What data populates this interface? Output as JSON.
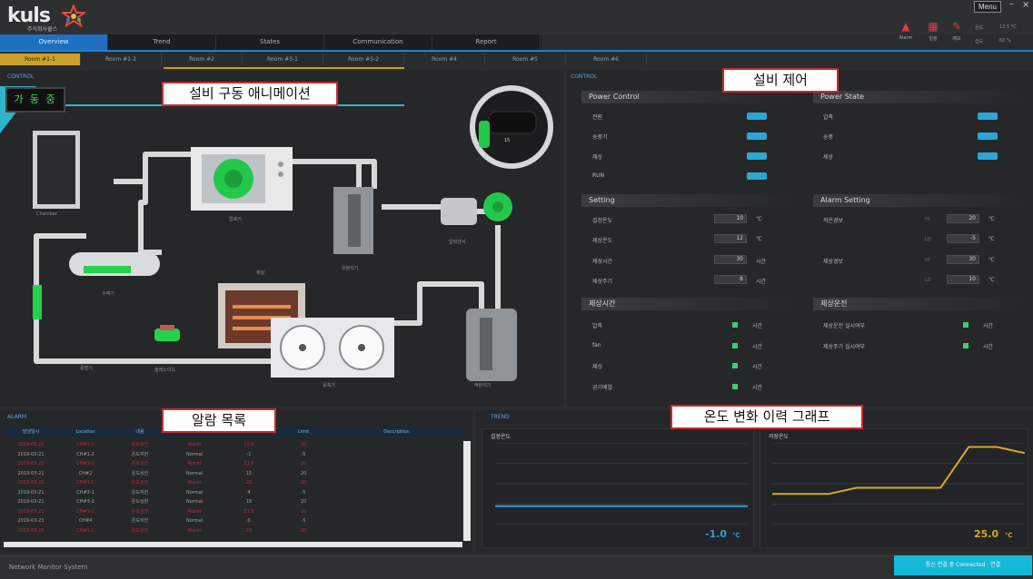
{
  "app": {
    "logo_text": "kuls",
    "logo_subtitle": "주식회사쿨스",
    "menu_label": "Menu",
    "minimize_glyph": "–",
    "close_glyph": "×"
  },
  "nav": {
    "tabs": [
      {
        "label": "Overview",
        "active": true
      },
      {
        "label": "Trend",
        "active": false
      },
      {
        "label": "States",
        "active": false
      },
      {
        "label": "Communication",
        "active": false
      },
      {
        "label": "Report",
        "active": false
      }
    ]
  },
  "subnav": {
    "tabs": [
      {
        "label": "Room #1-1",
        "active": true
      },
      {
        "label": "Room #1-2",
        "active": false
      },
      {
        "label": "Room #2",
        "active": false
      },
      {
        "label": "Room #3-1",
        "active": false
      },
      {
        "label": "Room #3-2",
        "active": false
      },
      {
        "label": "Room #4",
        "active": false
      },
      {
        "label": "Room #5",
        "active": false
      },
      {
        "label": "Room #6",
        "active": false
      }
    ]
  },
  "top_icons": [
    {
      "icon": "alarm-bell-icon",
      "label": "Alarm"
    },
    {
      "icon": "calendar-icon",
      "label": "일정"
    },
    {
      "icon": "edit-icon",
      "label": "메모"
    }
  ],
  "top_status": [
    "온도",
    "12.5 °C",
    "습도",
    "60 %"
  ],
  "animation_panel": {
    "title": "CONTROL",
    "display_value": "가 동 중",
    "equipment_labels": {
      "door": "Chamber",
      "compressor": "압축기",
      "receiver": "수액기",
      "filter": "유분리기",
      "pump": "압력센서",
      "valve": "솔레노이드",
      "heater": "제상",
      "condenser": "응축기",
      "accumulator": "액분리기",
      "evaporator_label": "증발기"
    },
    "gauge_value": "15"
  },
  "control_panel": {
    "title": "CONTROL",
    "power_control": {
      "heading": "Power Control",
      "rows": [
        "전원",
        "송풍기",
        "제상",
        "RUN"
      ]
    },
    "power_state": {
      "heading": "Power State",
      "rows": [
        "압축",
        "송풍",
        "제상"
      ]
    },
    "setting": {
      "heading": "Setting",
      "rows": [
        {
          "label": "설정온도",
          "value": "10",
          "unit": "℃"
        },
        {
          "label": "제상온도",
          "value": "12",
          "unit": "℃"
        },
        {
          "label": "제상시간",
          "value": "30",
          "unit": "시간"
        },
        {
          "label": "제상주기",
          "value": "8",
          "unit": "시간"
        }
      ]
    },
    "alarm_setting": {
      "heading": "Alarm Setting",
      "rows": [
        {
          "label": "저온경보",
          "hi": "HI",
          "value1": "20",
          "lo": "LO",
          "value2": "-5",
          "unit": "℃"
        },
        {
          "label": "제상경보",
          "hi": "HI",
          "value1": "30",
          "lo": "LO",
          "value2": "10",
          "unit": "℃"
        }
      ]
    },
    "run_time": {
      "heading": "제상시간",
      "rows": [
        "압축",
        "fan",
        "제상",
        "공기예열"
      ],
      "unit": "시간"
    },
    "defrost": {
      "heading": "제상운전",
      "rows": [
        "제상운전 실시여부",
        "제상주기 실시여부"
      ],
      "unit": "시간"
    }
  },
  "alarm_panel": {
    "title": "ALARM",
    "columns": [
      "발생일시",
      "Location",
      "내용",
      "Status",
      "Value",
      "Limit",
      "Description"
    ],
    "rows": [
      {
        "c": [
          "2019-03-21",
          "CH#1-1",
          "온도상한",
          "Alarm",
          "19.5",
          "20",
          ""
        ],
        "red": true
      },
      {
        "c": [
          "2019-03-21",
          "CH#1-2",
          "온도하한",
          "Normal",
          "-1",
          "-5",
          ""
        ],
        "red": false
      },
      {
        "c": [
          "2019-03-21",
          "CH#1-1",
          "온도상한",
          "Alarm",
          "21.0",
          "20",
          ""
        ],
        "red": true
      },
      {
        "c": [
          "2019-03-21",
          "CH#2",
          "온도상한",
          "Normal",
          "15",
          "20",
          ""
        ],
        "red": false
      },
      {
        "c": [
          "2019-03-21",
          "CH#1-1",
          "온도상한",
          "Alarm",
          "22",
          "20",
          ""
        ],
        "red": true
      },
      {
        "c": [
          "2019-03-21",
          "CH#3-1",
          "온도하한",
          "Normal",
          "4",
          "-5",
          ""
        ],
        "red": false
      },
      {
        "c": [
          "2019-03-21",
          "CH#3-2",
          "온도상한",
          "Normal",
          "18",
          "20",
          ""
        ],
        "red": false
      },
      {
        "c": [
          "2019-03-21",
          "CH#1-1",
          "온도상한",
          "Alarm",
          "21.5",
          "20",
          ""
        ],
        "red": true
      },
      {
        "c": [
          "2019-03-21",
          "CH#4",
          "온도하한",
          "Normal",
          "0",
          "-5",
          ""
        ],
        "red": false
      },
      {
        "c": [
          "2019-03-21",
          "CH#1-1",
          "온도상한",
          "Alarm",
          "23",
          "20",
          ""
        ],
        "red": true
      }
    ]
  },
  "graph_panel": {
    "title": "TREND",
    "charts": [
      {
        "legend": "설정온도",
        "current": "-1.0",
        "unit": "℃",
        "color": "#2f9fd0"
      },
      {
        "legend": "저장온도",
        "current": "25.0",
        "unit": "℃",
        "color": "#d9a72b"
      }
    ],
    "chart_data": [
      {
        "type": "line",
        "series": [
          {
            "name": "설정온도",
            "values": [
              -1,
              -1,
              -1,
              -1,
              -1,
              -1,
              -1,
              -1,
              -1,
              -1
            ]
          }
        ],
        "ylim": [
          -10,
          30
        ]
      },
      {
        "type": "line",
        "series": [
          {
            "name": "저장온도",
            "values": [
              5,
              5,
              5,
              8,
              8,
              8,
              8,
              28,
              28,
              25
            ]
          }
        ],
        "ylim": [
          -10,
          30
        ]
      }
    ]
  },
  "statusbar": {
    "text": "Network Monitor System",
    "button_label": "통신 연결 중  Connected  · 연결"
  },
  "annotations": {
    "animation": "설비 구동 애니메이션",
    "control": "설비 제어",
    "alarm": "알람 목록",
    "graph": "온도 변화 이력 그래프"
  },
  "colors": {
    "accent_blue": "#1e6fc0",
    "accent_gold": "#c9a22a",
    "status_cyan": "#15b9d8",
    "alarm_red": "#c8283a"
  }
}
